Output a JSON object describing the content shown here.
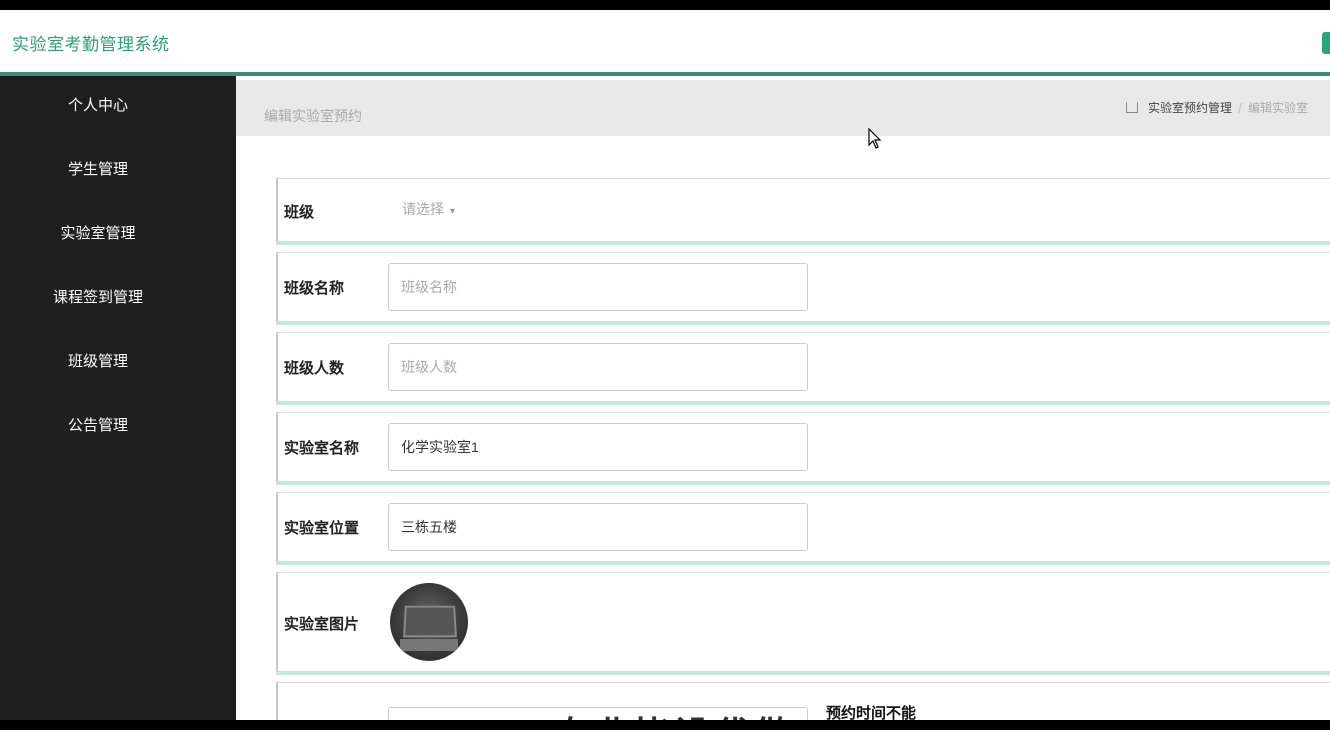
{
  "app": {
    "title": "实验室考勤管理系统",
    "accent": "#2f9e7a"
  },
  "sidebar": {
    "items": [
      {
        "label": "个人中心"
      },
      {
        "label": "学生管理"
      },
      {
        "label": "实验室管理"
      },
      {
        "label": "课程签到管理"
      },
      {
        "label": "班级管理"
      },
      {
        "label": "公告管理"
      }
    ]
  },
  "header": {
    "page_title": "编辑实验室预约",
    "breadcrumb": {
      "home_icon": "home-icon",
      "first": "实验室预约管理",
      "current": "编辑实验室"
    }
  },
  "form": {
    "class": {
      "label": "班级",
      "placeholder": "请选择"
    },
    "class_name": {
      "label": "班级名称",
      "placeholder": "班级名称",
      "value": ""
    },
    "class_size": {
      "label": "班级人数",
      "placeholder": "班级人数",
      "value": ""
    },
    "lab_name": {
      "label": "实验室名称",
      "value": "化学实验室1"
    },
    "lab_location": {
      "label": "实验室位置",
      "value": "三栋五楼"
    },
    "lab_image": {
      "label": "实验室图片"
    },
    "partial_note": "预约时间不能",
    "partial_big": "专业毕设代做"
  }
}
